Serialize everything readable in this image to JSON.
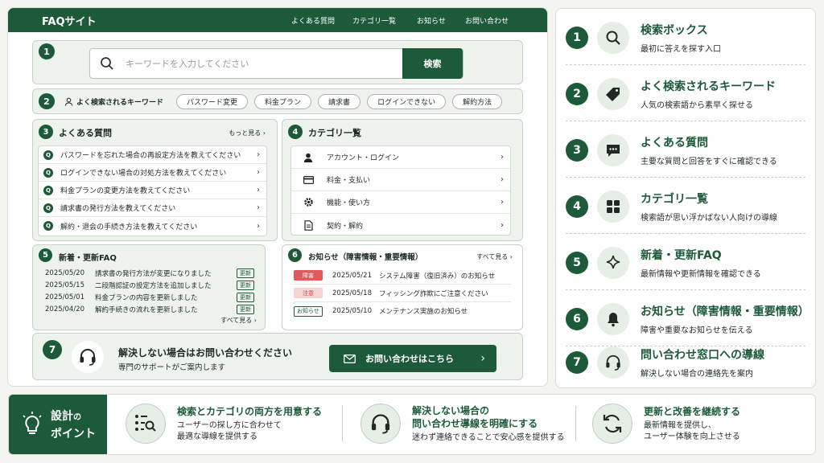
{
  "site": {
    "logo": "FAQサイト",
    "nav": [
      "よくある質問",
      "カテゴリ一覧",
      "お知らせ",
      "お問い合わせ"
    ]
  },
  "search": {
    "num": "1",
    "placeholder": "キーワードを入力してください",
    "button": "検索"
  },
  "keywords": {
    "num": "2",
    "label": "よく検索されるキーワード",
    "tags": [
      "パスワード変更",
      "料金プラン",
      "請求書",
      "ログインできない",
      "解約方法"
    ]
  },
  "faq": {
    "num": "3",
    "title": "よくある質問",
    "more": "もっと見る ›",
    "q_mark": "Q",
    "items": [
      "パスワードを忘れた場合の再設定方法を教えてください",
      "ログインできない場合の対処方法を教えてください",
      "料金プランの変更方法を教えてください",
      "請求書の発行方法を教えてください",
      "解約・退会の手続き方法を教えてください"
    ]
  },
  "category": {
    "num": "4",
    "title": "カテゴリ一覧",
    "items": [
      {
        "label": "アカウント・ログイン",
        "icon": "user-icon"
      },
      {
        "label": "料金・支払い",
        "icon": "card-icon"
      },
      {
        "label": "機能・使い方",
        "icon": "gear-icon"
      },
      {
        "label": "契約・解約",
        "icon": "document-icon"
      }
    ]
  },
  "news": {
    "num": "5",
    "title": "新着・更新FAQ",
    "badge": "更新",
    "more": "すべて見る ›",
    "items": [
      {
        "date": "2025/05/20",
        "text": "請求書の発行方法が変更になりました"
      },
      {
        "date": "2025/05/15",
        "text": "二段階認証の設定方法を追加しました"
      },
      {
        "date": "2025/05/01",
        "text": "料金プランの内容を更新しました"
      },
      {
        "date": "2025/04/20",
        "text": "解約手続きの流れを更新しました"
      }
    ]
  },
  "notice": {
    "num": "6",
    "title": "お知らせ（障害情報・重要情報）",
    "more": "すべて見る ›",
    "items": [
      {
        "type": "障害",
        "date": "2025/05/21",
        "text": "システム障害（復旧済み）のお知らせ",
        "color": "#e05a5a"
      },
      {
        "type": "注意",
        "date": "2025/05/18",
        "text": "フィッシング詐欺にご注意ください",
        "color": "#f4c9c9"
      },
      {
        "type": "お知らせ",
        "date": "2025/05/10",
        "text": "メンテナンス実施のお知らせ",
        "color": "#1c5a3a"
      }
    ]
  },
  "contact": {
    "num": "7",
    "title": "解決しない場合はお問い合わせください",
    "sub": "専門のサポートがご案内します",
    "button": "お問い合わせはこちら"
  },
  "right": [
    {
      "num": "1",
      "title": "検索ボックス",
      "desc": "最初に答えを探す入口",
      "icon": "search-icon"
    },
    {
      "num": "2",
      "title": "よく検索されるキーワード",
      "desc": "人気の検索語から素早く探せる",
      "icon": "tag-icon"
    },
    {
      "num": "3",
      "title": "よくある質問",
      "desc": "主要な質問と回答をすぐに確認できる",
      "icon": "chat-icon"
    },
    {
      "num": "4",
      "title": "カテゴリ一覧",
      "desc": "検索語が思い浮かばない人向けの導線",
      "icon": "grid-icon"
    },
    {
      "num": "5",
      "title": "新着・更新FAQ",
      "desc": "最新情報や更新情報を確認できる",
      "icon": "sparkle-icon"
    },
    {
      "num": "6",
      "title": "お知らせ（障害情報・重要情報）",
      "desc": "障害や重要なお知らせを伝える",
      "icon": "bell-icon"
    },
    {
      "num": "7",
      "title": "問い合わせ窓口への導線",
      "desc": "解決しない場合の連絡先を案内",
      "icon": "headset-icon"
    }
  ],
  "points": {
    "label_a": "設計",
    "label_b": "の",
    "label_c": "ポイント",
    "items": [
      {
        "title": "検索とカテゴリの両方を用意する",
        "desc1": "ユーザーの探し方に合わせて",
        "desc2": "最適な導線を提供する",
        "icon": "list-search-icon"
      },
      {
        "title": "解決しない場合の",
        "title2": "問い合わせ導線を明確にする",
        "desc1": "迷わず連絡できることで安心感を提供する",
        "icon": "headset-icon"
      },
      {
        "title": "更新と改善を継続する",
        "desc1": "最新情報を提供し、",
        "desc2": "ユーザー体験を向上させる",
        "icon": "refresh-icon"
      }
    ]
  },
  "colors": {
    "brand": "#1c5a3a",
    "panel": "#eef3ee",
    "alert": "#e05a5a"
  }
}
